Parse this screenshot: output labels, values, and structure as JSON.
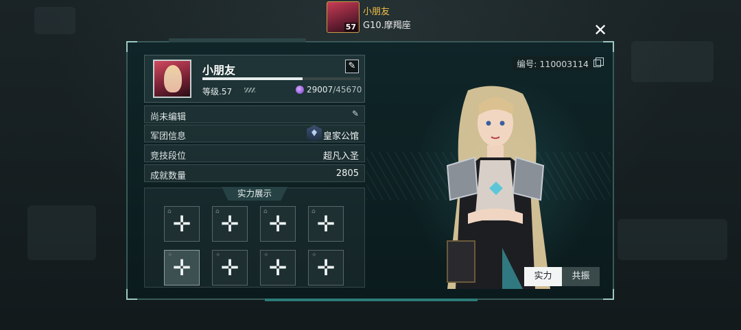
{
  "header": {
    "player_name": "小朋友",
    "player_level": "57",
    "group": "G10.摩羯座",
    "close_icon": "close-icon"
  },
  "profile": {
    "name": "小朋友",
    "level_label": "等级.57",
    "exp_current": "29007",
    "exp_max": "/45670",
    "exp_progress": 0.635,
    "id_label": "编号: 110003114"
  },
  "info_rows": [
    {
      "label": "尚未编辑",
      "value": ""
    },
    {
      "label": "军团信息",
      "value": "皇家公馆"
    },
    {
      "label": "竞技段位",
      "value": "超凡入圣"
    },
    {
      "label": "成就数量",
      "value": "2805"
    }
  ],
  "power_showcase": {
    "title": "实力展示",
    "slot_symbol": "✛"
  },
  "toggles": {
    "strength": "实力",
    "resonance": "共振"
  }
}
